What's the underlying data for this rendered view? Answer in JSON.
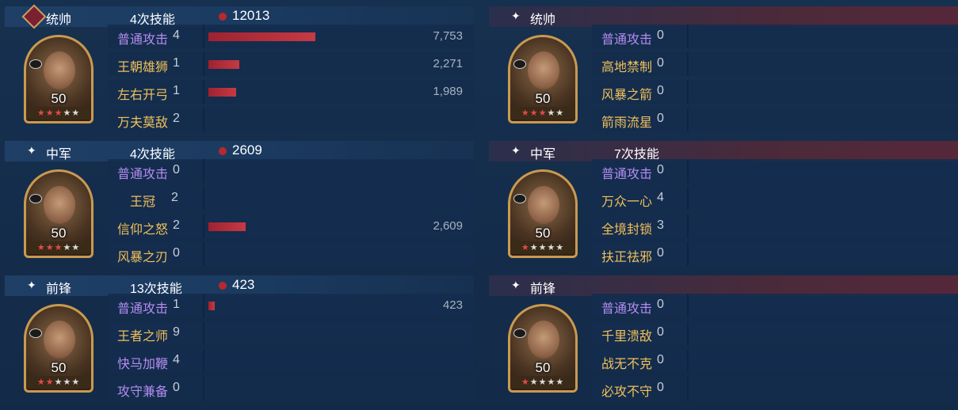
{
  "left": [
    {
      "role": "统帅",
      "count": "4次技能",
      "damage": "12013",
      "level": "50",
      "red_stars": 3,
      "skills": [
        {
          "name": "普通攻击",
          "lv": "4",
          "color": "purple",
          "value": "7,753",
          "fill": 0.45
        },
        {
          "name": "王朝雄狮",
          "lv": "1",
          "color": "gold",
          "value": "2,271",
          "fill": 0.13
        },
        {
          "name": "左右开弓",
          "lv": "1",
          "color": "gold",
          "value": "1,989",
          "fill": 0.115
        },
        {
          "name": "万夫莫敌",
          "lv": "2",
          "color": "gold",
          "value": "",
          "fill": 0
        }
      ]
    },
    {
      "role": "中军",
      "count": "4次技能",
      "damage": "2609",
      "level": "50",
      "red_stars": 3,
      "skills": [
        {
          "name": "普通攻击",
          "lv": "0",
          "color": "purple",
          "value": "",
          "fill": 0
        },
        {
          "name": "王冠",
          "lv": "2",
          "color": "gold",
          "value": "",
          "fill": 0
        },
        {
          "name": "信仰之怒",
          "lv": "2",
          "color": "gold",
          "value": "2,609",
          "fill": 0.155
        },
        {
          "name": "风暴之刃",
          "lv": "0",
          "color": "gold",
          "value": "",
          "fill": 0
        }
      ]
    },
    {
      "role": "前锋",
      "count": "13次技能",
      "damage": "423",
      "level": "50",
      "red_stars": 2,
      "skills": [
        {
          "name": "普通攻击",
          "lv": "1",
          "color": "purple",
          "value": "423",
          "fill": 0.025
        },
        {
          "name": "王者之师",
          "lv": "9",
          "color": "gold",
          "value": "",
          "fill": 0
        },
        {
          "name": "快马加鞭",
          "lv": "4",
          "color": "purple",
          "value": "",
          "fill": 0
        },
        {
          "name": "攻守兼备",
          "lv": "0",
          "color": "purple",
          "value": "",
          "fill": 0
        }
      ]
    }
  ],
  "right": [
    {
      "role": "统帅",
      "count": "",
      "level": "50",
      "red_stars": 3,
      "skills": [
        {
          "name": "普通攻击",
          "lv": "0",
          "color": "purple"
        },
        {
          "name": "高地禁制",
          "lv": "0",
          "color": "gold"
        },
        {
          "name": "风暴之箭",
          "lv": "0",
          "color": "gold"
        },
        {
          "name": "箭雨流星",
          "lv": "0",
          "color": "gold"
        }
      ]
    },
    {
      "role": "中军",
      "count": "7次技能",
      "level": "50",
      "red_stars": 1,
      "skills": [
        {
          "name": "普通攻击",
          "lv": "0",
          "color": "purple"
        },
        {
          "name": "万众一心",
          "lv": "4",
          "color": "gold"
        },
        {
          "name": "全境封锁",
          "lv": "3",
          "color": "gold"
        },
        {
          "name": "扶正祛邪",
          "lv": "0",
          "color": "gold"
        }
      ]
    },
    {
      "role": "前锋",
      "count": "",
      "level": "50",
      "red_stars": 1,
      "skills": [
        {
          "name": "普通攻击",
          "lv": "0",
          "color": "purple"
        },
        {
          "name": "千里溃敌",
          "lv": "0",
          "color": "gold"
        },
        {
          "name": "战无不克",
          "lv": "0",
          "color": "gold"
        },
        {
          "name": "必攻不守",
          "lv": "0",
          "color": "gold"
        }
      ]
    }
  ]
}
